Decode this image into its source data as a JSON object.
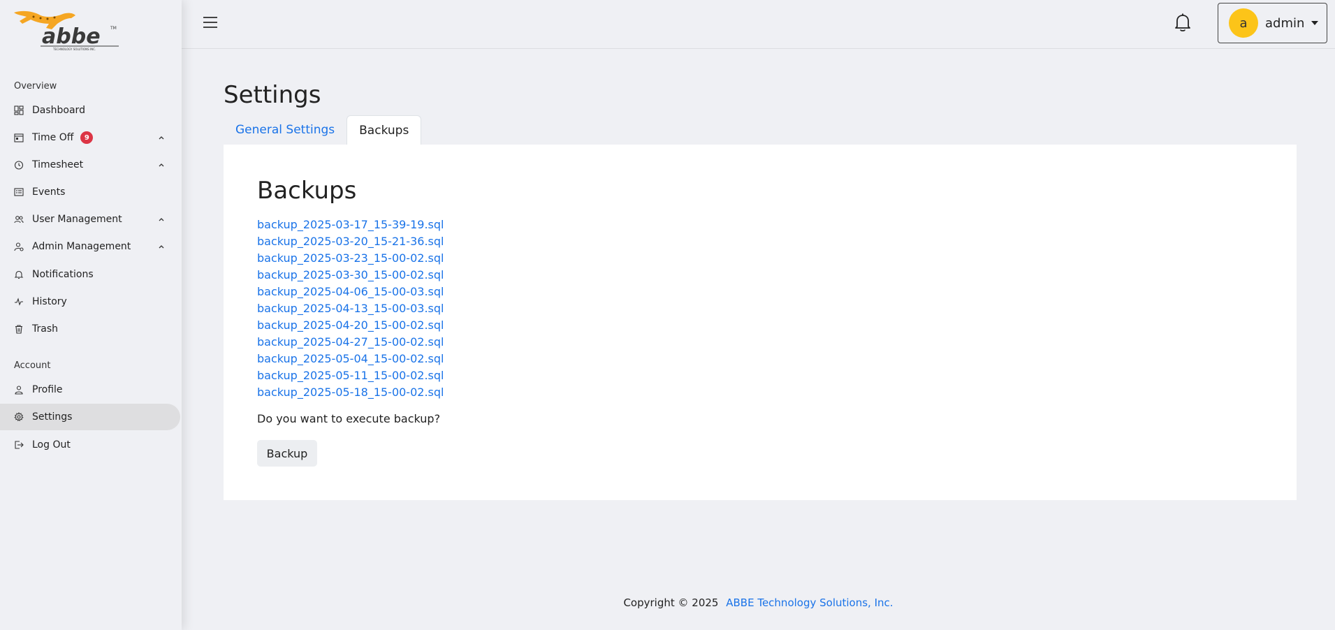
{
  "brand": {
    "logo_text": "abbe",
    "logo_tm": "TM",
    "logo_subtext": "TECHNOLOGY SOLUTIONS INC.",
    "accent": "#f5a623"
  },
  "sidebar": {
    "overview_label": "Overview",
    "account_label": "Account",
    "items": [
      {
        "label": "Dashboard",
        "icon": "dashboard-icon"
      },
      {
        "label": "Time Off",
        "icon": "calendar-icon",
        "badge": "9"
      },
      {
        "label": "Timesheet",
        "icon": "clock-icon"
      },
      {
        "label": "Events",
        "icon": "events-icon"
      },
      {
        "label": "User Management",
        "icon": "users-icon"
      },
      {
        "label": "Admin Management",
        "icon": "admin-icon"
      },
      {
        "label": "Notifications",
        "icon": "bell-icon"
      },
      {
        "label": "History",
        "icon": "activity-icon"
      },
      {
        "label": "Trash",
        "icon": "trash-icon"
      }
    ],
    "account_items": [
      {
        "label": "Profile",
        "icon": "user-icon"
      },
      {
        "label": "Settings",
        "icon": "gear-icon",
        "active": true
      },
      {
        "label": "Log Out",
        "icon": "logout-icon"
      }
    ]
  },
  "header": {
    "avatar_initial": "a",
    "user_name": "admin",
    "avatar_color": "#fcc419"
  },
  "main": {
    "title": "Settings",
    "tabs": [
      {
        "label": "General Settings",
        "active": false
      },
      {
        "label": "Backups",
        "active": true
      }
    ],
    "panel_title": "Backups",
    "backups": [
      "backup_2025-03-17_15-39-19.sql",
      "backup_2025-03-20_15-21-36.sql",
      "backup_2025-03-23_15-00-02.sql",
      "backup_2025-03-30_15-00-02.sql",
      "backup_2025-04-06_15-00-03.sql",
      "backup_2025-04-13_15-00-03.sql",
      "backup_2025-04-20_15-00-02.sql",
      "backup_2025-04-27_15-00-02.sql",
      "backup_2025-05-04_15-00-02.sql",
      "backup_2025-05-11_15-00-02.sql",
      "backup_2025-05-18_15-00-02.sql"
    ],
    "question": "Do you want to execute backup?",
    "backup_button": "Backup"
  },
  "footer": {
    "copyright": "Copyright © 2025",
    "company": "ABBE Technology Solutions, Inc."
  },
  "colors": {
    "link": "#1a73e8",
    "badge": "#dc3545",
    "background": "#eff0f4"
  }
}
